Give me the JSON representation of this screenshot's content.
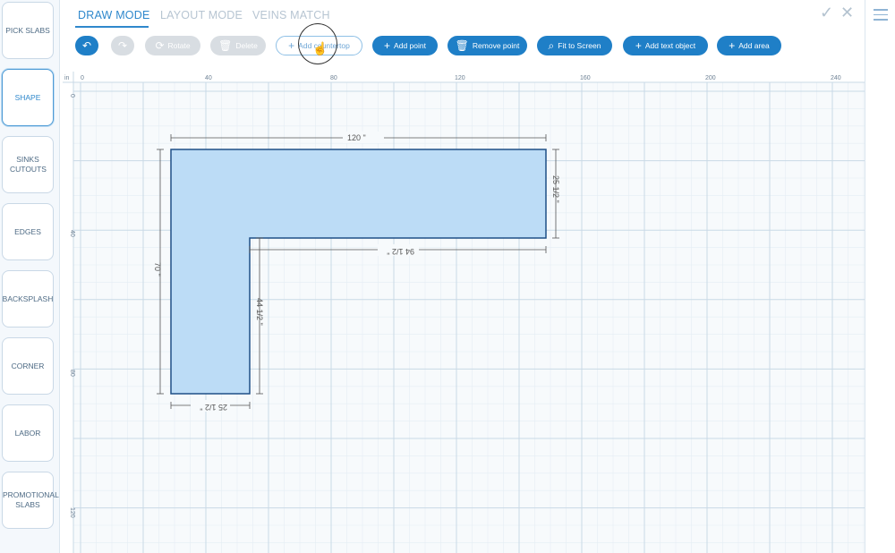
{
  "sidebar": {
    "items": [
      {
        "label": "PICK SLABS",
        "active": false
      },
      {
        "label": "SHAPE",
        "active": true
      },
      {
        "label": "SINKS CUTOUTS",
        "active": false
      },
      {
        "label": "EDGES",
        "active": false
      },
      {
        "label": "BACKSPLASH",
        "active": false
      },
      {
        "label": "CORNER",
        "active": false
      },
      {
        "label": "LABOR",
        "active": false
      },
      {
        "label": "PROMOTIONAL SLABS",
        "active": false
      }
    ]
  },
  "tabs": [
    {
      "label": "DRAW MODE",
      "active": true
    },
    {
      "label": "LAYOUT MODE",
      "active": false
    },
    {
      "label": "VEINS MATCH",
      "active": false
    }
  ],
  "toolbar": {
    "undo_icon": "undo-icon",
    "redo_icon": "redo-icon",
    "rotate": "Rotate",
    "delete": "Delete",
    "add_countertop": "Add countertop",
    "add_point": "Add point",
    "remove_point": "Remove point",
    "fit_to_screen": "Fit to Screen",
    "add_text_object": "Add text object",
    "add_area": "Add area"
  },
  "ruler": {
    "unit": "in",
    "x_labels": [
      "0",
      "40",
      "80",
      "120",
      "160",
      "200",
      "240"
    ],
    "y_labels": [
      "0",
      "40",
      "80",
      "120"
    ]
  },
  "dimensions": {
    "top": "120 \"",
    "right": "25 1/2 \"",
    "inner_horizontal": "94 1/2 \"",
    "left": "70 \"",
    "inner_vertical": "44 1/2 \"",
    "bottom": "25 1/2 \""
  },
  "colors": {
    "accent": "#1f7fc7",
    "shape_fill": "#bcdcf6",
    "shape_stroke": "#1f4f86",
    "grid_minor": "#e4edf4",
    "grid_major": "#c9d9e6"
  }
}
